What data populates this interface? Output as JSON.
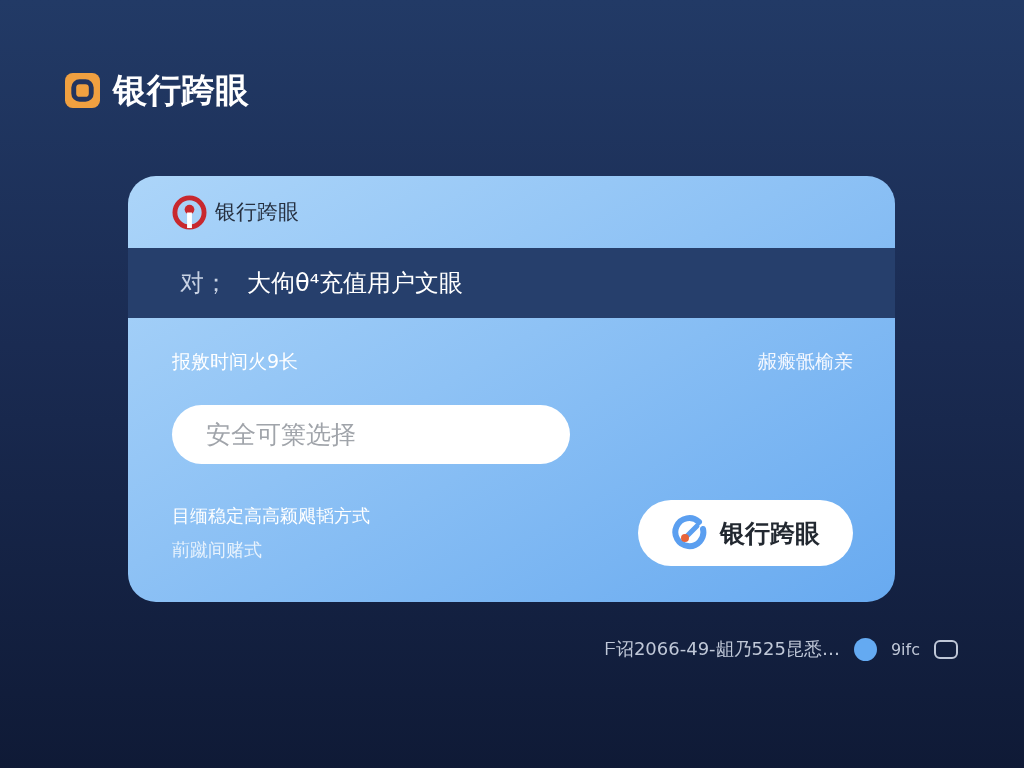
{
  "header": {
    "title": "银行跨眼"
  },
  "card": {
    "brand": "银行跨眼",
    "banner": {
      "label": "对；",
      "text": "大佝θ⁴充值用户文眼"
    },
    "row_label": "报敫时间火9长",
    "row_link": "赧瘢骶榆亲",
    "input": {
      "placeholder": "安全可篥选择"
    },
    "notes": [
      "目缅稳定高高颖飓韬方式",
      "萷蹴间赌式"
    ],
    "button": "银行跨眼"
  },
  "footer": {
    "text": "ᖴ诏2066-49-龃乃525昆悉…",
    "options": [
      {
        "selected": true,
        "label": "9ifc"
      },
      {
        "selected": false
      }
    ]
  }
}
